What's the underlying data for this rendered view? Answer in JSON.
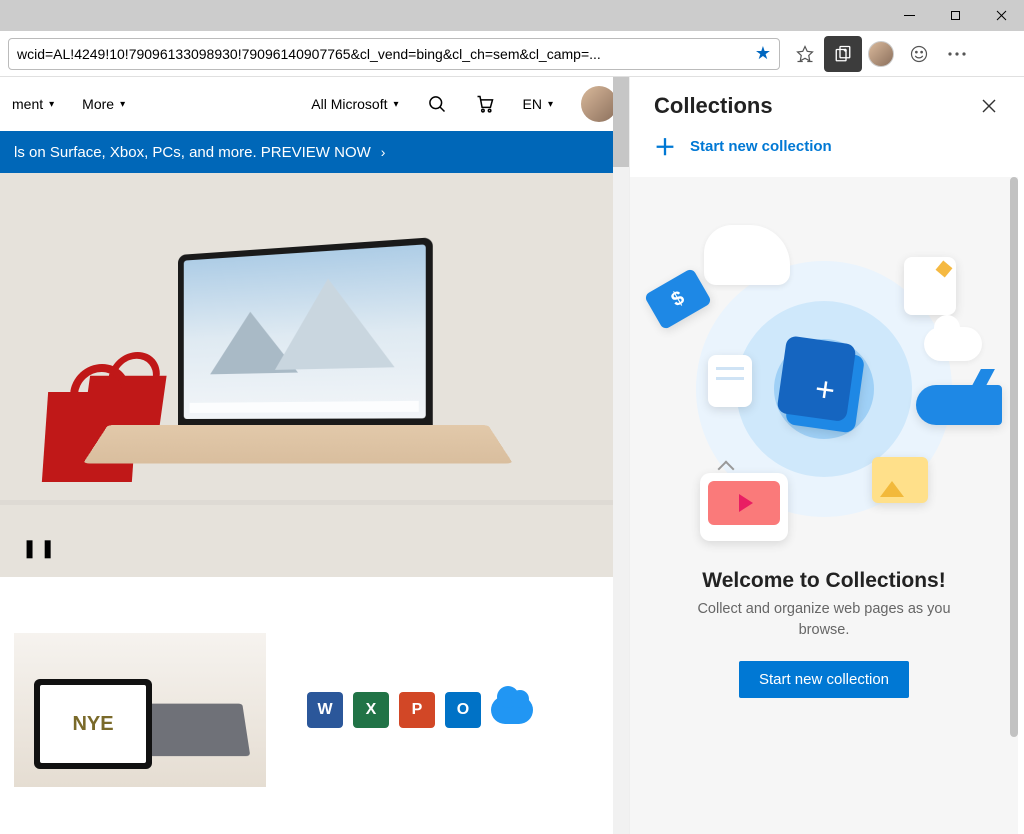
{
  "window": {
    "minimize_label": "Minimize",
    "maximize_label": "Maximize",
    "close_label": "Close"
  },
  "address_bar": {
    "url_fragment": "wcid=AL!4249!10!79096133098930!79096140907765&cl_vend=bing&cl_ch=sem&cl_camp=..."
  },
  "page_nav": {
    "item1": "ment",
    "more": "More",
    "all_ms": "All Microsoft",
    "lang": "EN"
  },
  "promo_bar": {
    "text": "ls on Surface, Xbox, PCs, and more. PREVIEW NOW"
  },
  "hero": {
    "tablet_text": "NYE"
  },
  "office_icons": {
    "word": "W",
    "excel": "X",
    "powerpoint": "P",
    "outlook": "O"
  },
  "collections": {
    "title": "Collections",
    "start_link": "Start new collection",
    "welcome_title": "Welcome to Collections!",
    "welcome_text": "Collect and organize web pages as you browse.",
    "button": "Start new collection"
  }
}
